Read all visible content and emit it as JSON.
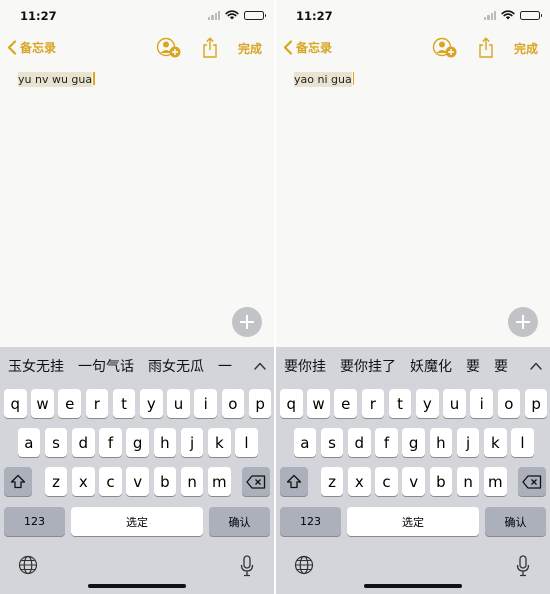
{
  "screens": [
    {
      "status": {
        "time": "11:27"
      },
      "nav": {
        "back_label": "备忘录",
        "done_label": "完成"
      },
      "note": {
        "text": "yu nv wu gua"
      },
      "candidates": [
        "玉女无挂",
        "一句气话",
        "雨女无瓜",
        "一"
      ],
      "keyboard": {
        "row1": [
          "q",
          "w",
          "e",
          "r",
          "t",
          "y",
          "u",
          "i",
          "o",
          "p"
        ],
        "row2": [
          "a",
          "s",
          "d",
          "f",
          "g",
          "h",
          "j",
          "k",
          "l"
        ],
        "row3": [
          "z",
          "x",
          "c",
          "v",
          "b",
          "n",
          "m"
        ],
        "numbers_label": "123",
        "space_label": "选定",
        "return_label": "确认"
      }
    },
    {
      "status": {
        "time": "11:27"
      },
      "nav": {
        "back_label": "备忘录",
        "done_label": "完成"
      },
      "note": {
        "text": "yao ni gua"
      },
      "candidates": [
        "要你挂",
        "要你挂了",
        "妖魔化",
        "要",
        "要"
      ],
      "keyboard": {
        "row1": [
          "q",
          "w",
          "e",
          "r",
          "t",
          "y",
          "u",
          "i",
          "o",
          "p"
        ],
        "row2": [
          "a",
          "s",
          "d",
          "f",
          "g",
          "h",
          "j",
          "k",
          "l"
        ],
        "row3": [
          "z",
          "x",
          "c",
          "v",
          "b",
          "n",
          "m"
        ],
        "numbers_label": "123",
        "space_label": "选定",
        "return_label": "确认"
      }
    }
  ],
  "colors": {
    "accent": "#d9a521",
    "note_bg": "#f8f8f7",
    "keyboard_bg": "#d3d5da",
    "key": "#ffffff",
    "key_dark": "#abb0ba"
  },
  "icons": [
    "back-chevron-icon",
    "add-collaborator-icon",
    "share-icon",
    "plus-icon",
    "shift-icon",
    "delete-icon",
    "globe-icon",
    "microphone-icon",
    "chevron-up-icon"
  ]
}
